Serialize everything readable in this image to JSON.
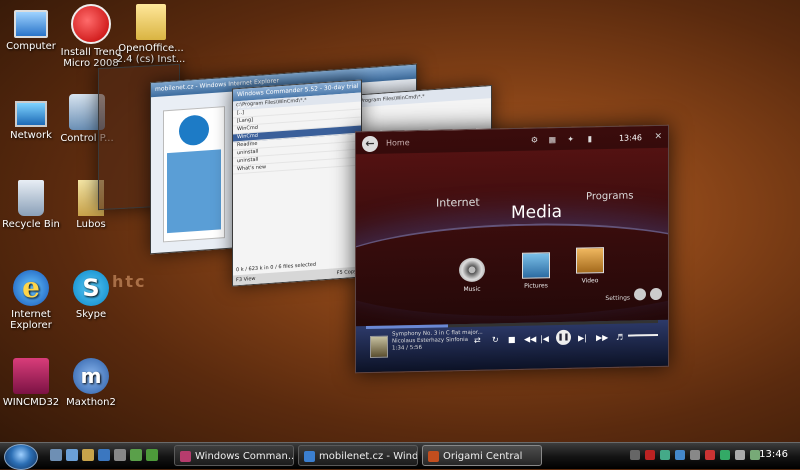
{
  "desktop": {
    "icons": [
      {
        "label": "Computer"
      },
      {
        "label": "Install Trend Micro 2008"
      },
      {
        "label": "OpenOffice... 2.4 (cs) Inst..."
      },
      {
        "label": "Network"
      },
      {
        "label": "Control P..."
      },
      {
        "label": "Recycle Bin"
      },
      {
        "label": "Lubos"
      },
      {
        "label": "Internet Explorer"
      },
      {
        "label": "Skype"
      },
      {
        "label": "WINCMD32"
      },
      {
        "label": "Maxthon2"
      }
    ],
    "watermark": "htc"
  },
  "flip3d": {
    "ie_window": {
      "title": "mobilenet.cz - Windows Internet Explorer",
      "logo": "mobilenet"
    },
    "tc_window": {
      "title": "Windows Commander 5.52 - 30-day trial version",
      "path": "c:\\Program Files\\WinCmd\\*.*",
      "rows": [
        "[..]",
        "[Lang]",
        "WinCmd",
        "WinCmd",
        "Readme",
        "uninstall",
        "uninstall",
        "What's new"
      ],
      "status": "0 k / 623 k in 0 / 6 files selected",
      "keys": [
        "F3 View",
        "F5 Copy"
      ]
    },
    "tc_right_panel": {
      "path": "c:\\Program Files\\WinCmd\\*.*"
    }
  },
  "media_center": {
    "home_label": "Home",
    "clock": "13:46",
    "categories": {
      "internet": "Internet",
      "media": "Media",
      "programs": "Programs"
    },
    "tiles": {
      "music": "Music",
      "pictures": "Pictures",
      "video": "Video"
    },
    "settings_label": "Settings",
    "now_playing": {
      "title": "Symphony No. 3 in C flat major...",
      "artist": "Nicolaus Esterhazy Sinfonia",
      "time": "1:34 / 5:56",
      "progress": 0.28
    }
  },
  "taskbar": {
    "buttons": [
      {
        "label": "Windows Comman..."
      },
      {
        "label": "mobilenet.cz - Wind..."
      },
      {
        "label": "Origami Central"
      }
    ],
    "clock": "13:46"
  }
}
